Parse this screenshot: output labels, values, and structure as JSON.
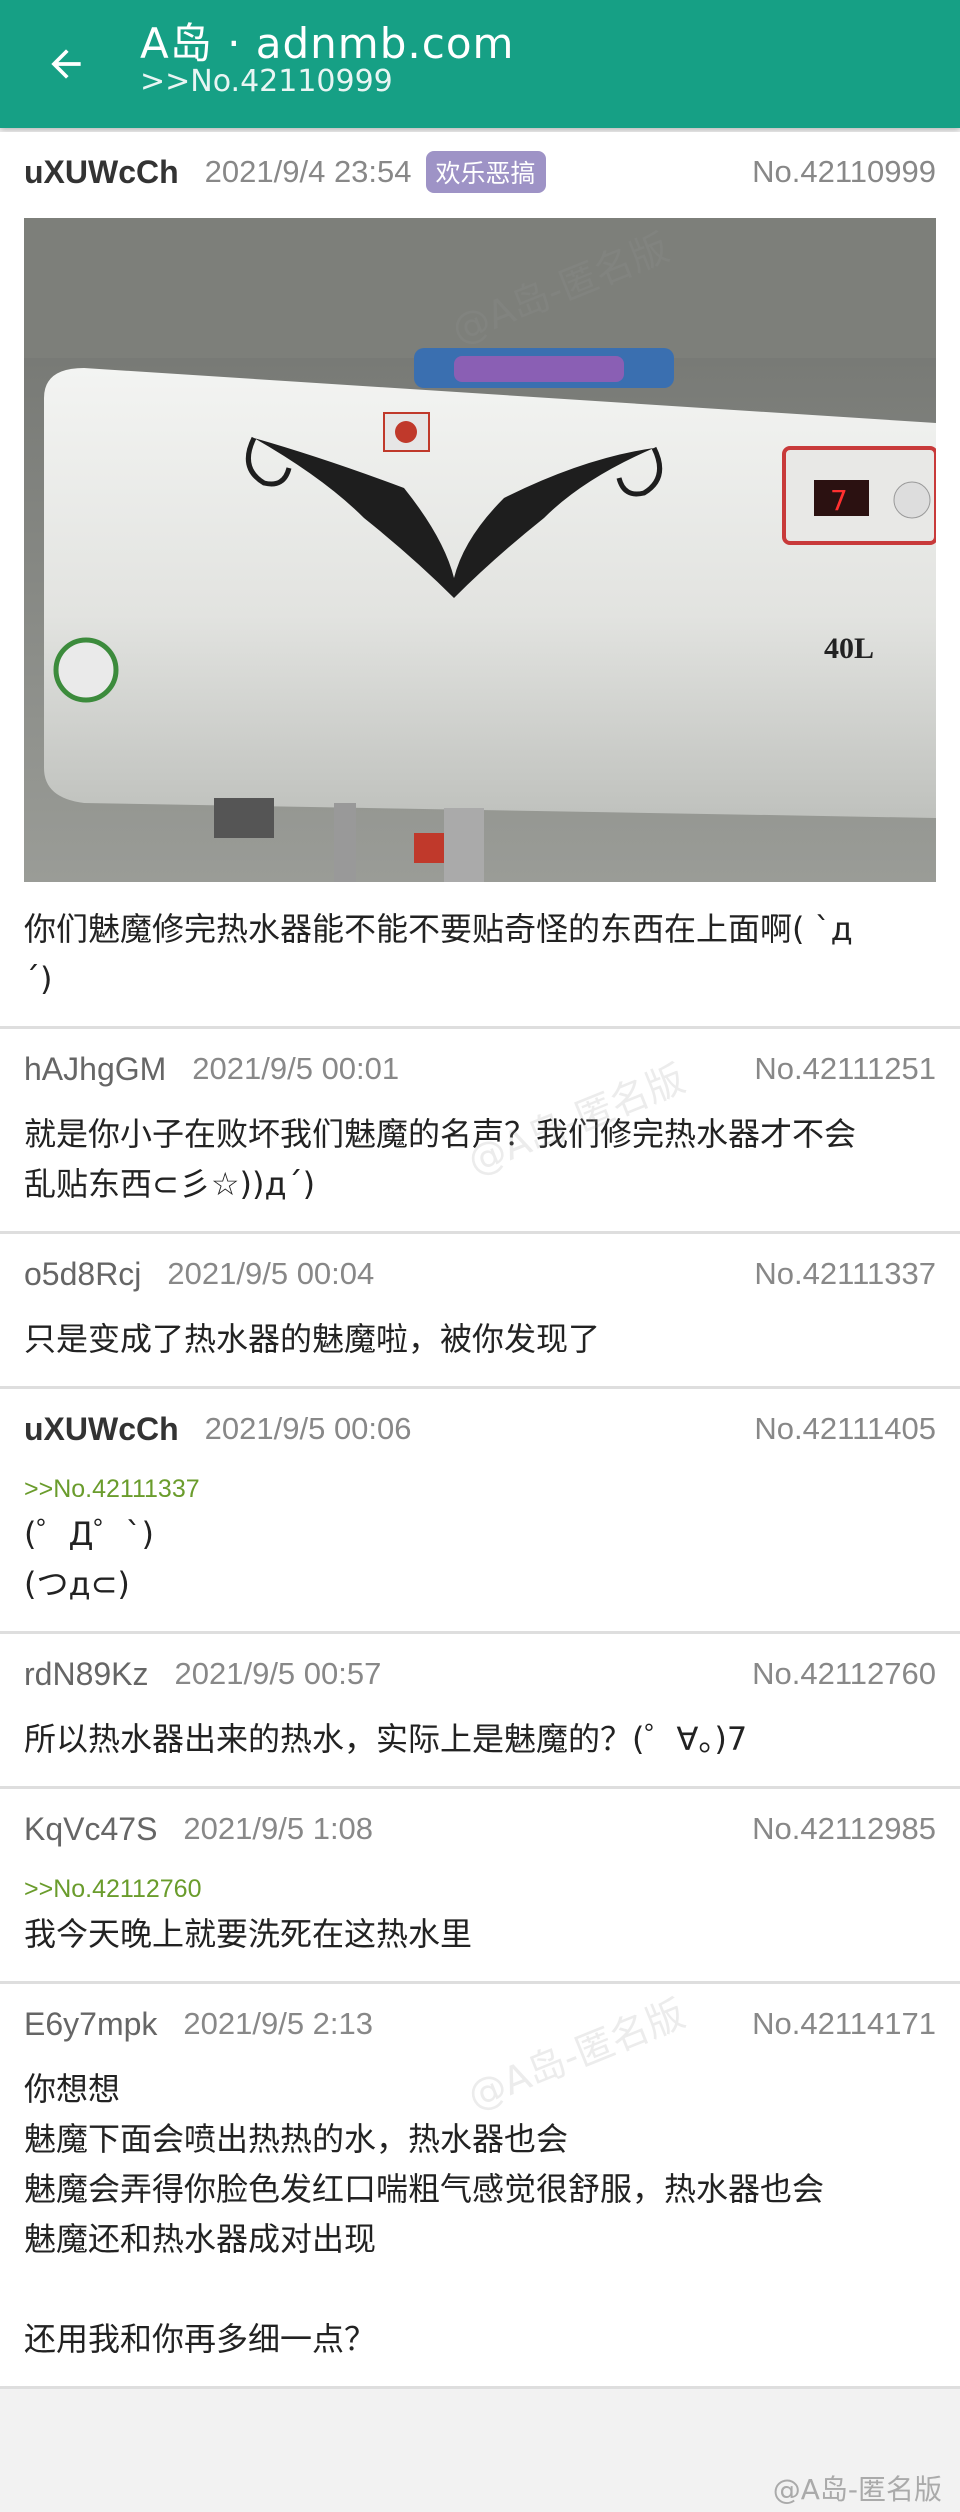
{
  "header": {
    "title": "A岛 · adnmb.com",
    "subtitle": ">>No.42110999"
  },
  "posts": [
    {
      "uid": "uXUWcCh",
      "time": "2021/9/4 23:54",
      "tag": "欢乐恶搞",
      "no": "No.42110999",
      "image_text": "40L",
      "image_display": "7",
      "content": "你们魅魔修完热水器能不能不要贴奇怪的东西在上面啊( `д\n´)"
    },
    {
      "uid": "hAJhgGM",
      "time": "2021/9/5 00:01",
      "no": "No.42111251",
      "content": "就是你小子在败坏我们魅魔的名声？我们修完热水器才不会\n乱贴东西⊂彡☆))д´)"
    },
    {
      "uid": "o5d8Rcj",
      "time": "2021/9/5 00:04",
      "no": "No.42111337",
      "content": "只是变成了热水器的魅魔啦，被你发现了"
    },
    {
      "uid": "uXUWcCh",
      "time": "2021/9/5 00:06",
      "no": "No.42111405",
      "quote": ">>No.42111337",
      "content": "(゜Д゜`)\n(つд⊂)"
    },
    {
      "uid": "rdN89Kz",
      "time": "2021/9/5 00:57",
      "no": "No.42112760",
      "content": "所以热水器出来的热水，实际上是魅魔的？(゜∀。)7"
    },
    {
      "uid": "KqVc47S",
      "time": "2021/9/5 1:08",
      "no": "No.42112985",
      "quote": ">>No.42112760",
      "content": "我今天晚上就要洗死在这热水里"
    },
    {
      "uid": "E6y7mpk",
      "time": "2021/9/5 2:13",
      "no": "No.42114171",
      "content": "你想想\n魅魔下面会喷出热热的水，热水器也会\n魅魔会弄得你脸色发红口喘粗气感觉很舒服，热水器也会\n魅魔还和热水器成对出现\n\n还用我和你再多细一点？"
    }
  ],
  "watermark": "@A岛-匿名版",
  "colors": {
    "appbar": "#16a085",
    "tag": "#9e93c6",
    "quote": "#6a9c2c"
  }
}
